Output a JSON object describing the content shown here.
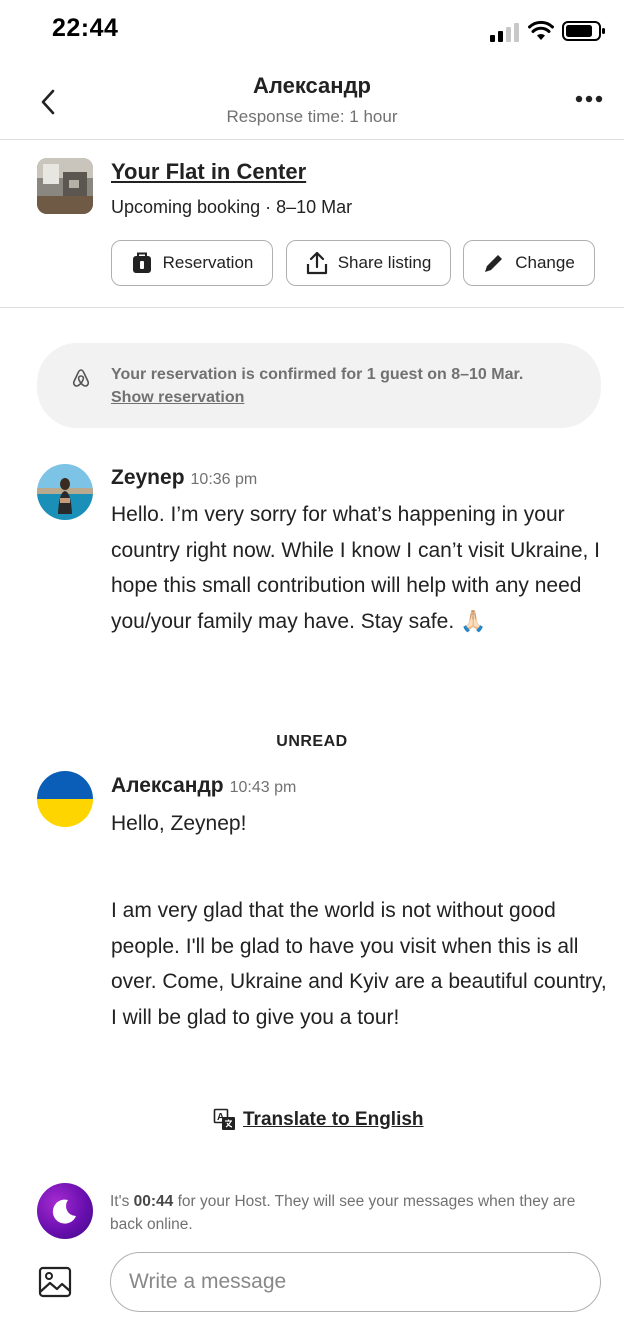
{
  "status_bar": {
    "time": "22:44"
  },
  "header": {
    "title": "Александр",
    "subtitle": "Response time: 1 hour"
  },
  "listing": {
    "title": "Your Flat in Center",
    "subtitle": "Upcoming booking · 8–10 Mar",
    "actions": [
      {
        "label": "Reservation",
        "icon": "luggage-icon"
      },
      {
        "label": "Share listing",
        "icon": "share-icon"
      },
      {
        "label": "Change",
        "icon": "pencil-icon"
      }
    ]
  },
  "system_message": {
    "text": "Your reservation is confirmed for 1 guest on 8–10 Mar.",
    "link": "Show reservation"
  },
  "messages": [
    {
      "author": "Zeynep",
      "time": "10:36 pm",
      "text": "Hello. I’m very sorry for what’s happening in your country right now. While I know I can’t visit Ukraine, I hope this small contribution will help with any need you/your family may have. Stay safe. 🙏🏻"
    },
    {
      "author": "Александр",
      "time": "10:43 pm",
      "text": "Hello, Zeynep!",
      "text2": "I am very glad that the world is not without good people. I'll be glad to have you visit when this is all over. Come, Ukraine and Kyiv are a beautiful country, I will be glad to give you a tour!"
    }
  ],
  "unread_label": "UNREAD",
  "translate_label": "Translate to English",
  "host_note": {
    "prefix": "It's ",
    "time": "00:44",
    "suffix": " for your Host. They will see your messages when they are back online."
  },
  "composer": {
    "placeholder": "Write a message"
  },
  "colors": {
    "text": "#222222",
    "muted": "#717171",
    "ukraine_blue": "#0a5eb8",
    "ukraine_yellow": "#ffd500",
    "host_purple": "#6a0fb0"
  }
}
